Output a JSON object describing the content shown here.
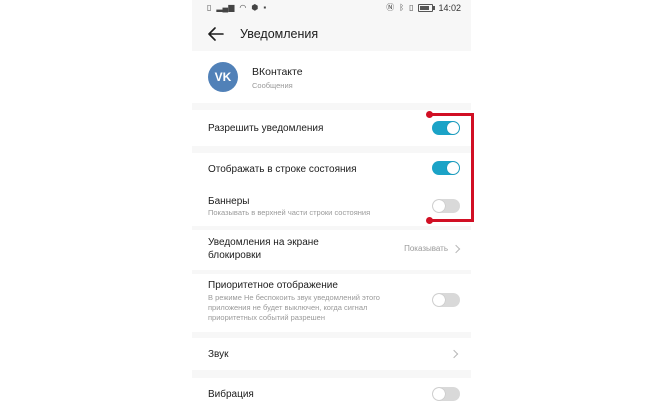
{
  "status_bar": {
    "left_icons": [
      "sim-icon",
      "signal-icon",
      "wifi-icon",
      "location-icon",
      "notification-icon"
    ],
    "right_icons": [
      "nfc-icon",
      "bluetooth-icon",
      "vibrate-icon",
      "battery-icon"
    ],
    "time": "14:02"
  },
  "header": {
    "title": "Уведомления"
  },
  "app": {
    "icon_text": "VK",
    "name": "ВКонтакте",
    "subtitle": "Сообщения"
  },
  "settings": {
    "allow": {
      "title": "Разрешить уведомления",
      "enabled": true
    },
    "status_bar_show": {
      "title": "Отображать в строке состояния",
      "enabled": true
    },
    "banners": {
      "title": "Баннеры",
      "description": "Показывать в верхней части строки состояния",
      "enabled": false
    },
    "lock_screen": {
      "title_line1": "Уведомления на экране",
      "title_line2": "блокировки",
      "value": "Показывать"
    },
    "priority": {
      "title": "Приоритетное отображение",
      "desc_line1": "В режиме Не беспокоить звук уведомлений этого",
      "desc_line2": "приложения не будет выключен, когда сигнал",
      "desc_line3": "приоритетных событий разрешен",
      "enabled": false
    },
    "sound": {
      "title": "Звук"
    },
    "vibration": {
      "title": "Вибрация",
      "enabled": false
    }
  },
  "colors": {
    "toggle_on": "#1ba3c7",
    "toggle_off": "#d9d9d9",
    "vk_brand": "#5181b8",
    "annotation": "#d10f24"
  }
}
